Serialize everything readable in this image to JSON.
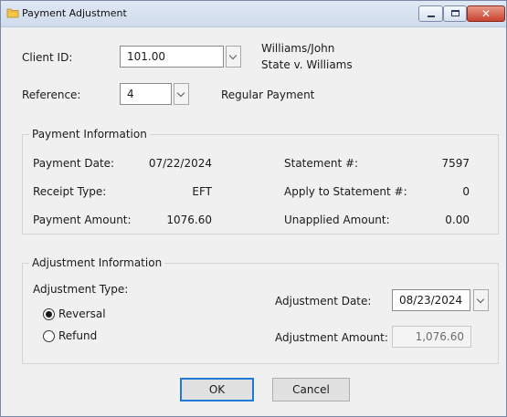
{
  "window": {
    "title": "Payment Adjustment"
  },
  "client": {
    "label": "Client ID:",
    "value": "101.00",
    "name_line1": "Williams/John",
    "name_line2": "State v. Williams"
  },
  "reference": {
    "label": "Reference:",
    "value": "4",
    "description": "Regular Payment"
  },
  "payment_info": {
    "title": "Payment Information",
    "payment_date_label": "Payment Date:",
    "payment_date": "07/22/2024",
    "receipt_type_label": "Receipt Type:",
    "receipt_type": "EFT",
    "payment_amount_label": "Payment Amount:",
    "payment_amount": "1076.60",
    "statement_label": "Statement #:",
    "statement": "7597",
    "apply_label": "Apply to Statement #:",
    "apply": "0",
    "unapplied_label": "Unapplied Amount:",
    "unapplied": "0.00"
  },
  "adjustment_info": {
    "title": "Adjustment Information",
    "type_label": "Adjustment Type:",
    "reversal_label": "Reversal",
    "refund_label": "Refund",
    "selected": "Reversal",
    "date_label": "Adjustment Date:",
    "date": "08/23/2024",
    "amount_label": "Adjustment Amount:",
    "amount": "1,076.60"
  },
  "buttons": {
    "ok": "OK",
    "cancel": "Cancel"
  },
  "icons": {
    "title": "folder-icon",
    "dropdown": "chevron-down-icon"
  },
  "colors": {
    "default_button_border": "#1f7ad6",
    "close_button": "#c8432e"
  }
}
